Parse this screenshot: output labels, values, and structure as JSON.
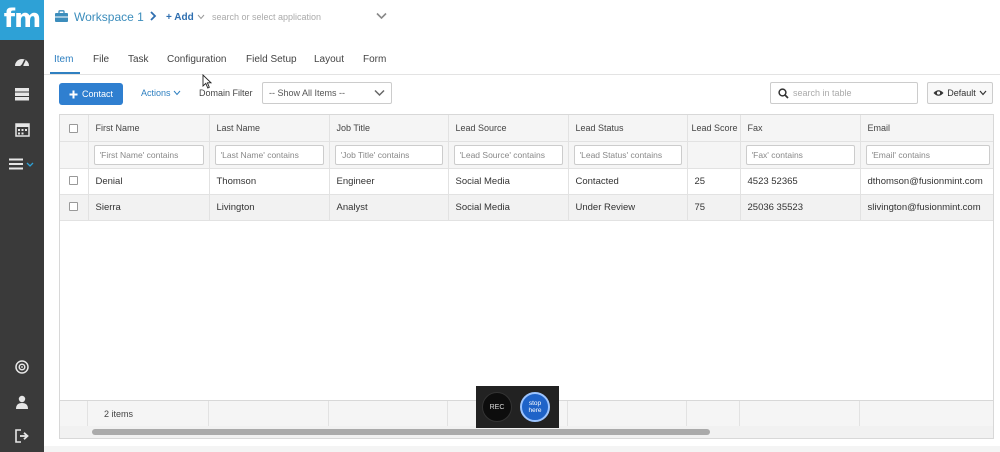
{
  "brand": {
    "logo_text": "fm",
    "accent": "#2ea1d6"
  },
  "topbar": {
    "workspace": "Workspace 1",
    "add_label": "Add",
    "app_search_placeholder": "search or select application"
  },
  "tabs": [
    {
      "label": "Item",
      "active": true
    },
    {
      "label": "File",
      "active": false
    },
    {
      "label": "Task",
      "active": false
    },
    {
      "label": "Configuration",
      "active": false
    },
    {
      "label": "Field Setup",
      "active": false
    },
    {
      "label": "Layout",
      "active": false
    },
    {
      "label": "Form",
      "active": false
    }
  ],
  "toolbar": {
    "add_contact_label": "Contact",
    "actions_label": "Actions",
    "domain_filter_label": "Domain Filter",
    "domain_filter_value": "-- Show All Items --",
    "search_placeholder": "search in table",
    "view_label": "Default"
  },
  "table": {
    "columns": [
      "First Name",
      "Last Name",
      "Job Title",
      "Lead Source",
      "Lead Status",
      "Lead Score",
      "Fax",
      "Email"
    ],
    "filters": [
      "'First Name' contains",
      "'Last Name' contains",
      "'Job Title' contains",
      "'Lead Source' contains",
      "'Lead Status' contains",
      "",
      "'Fax' contains",
      "'Email' contains"
    ],
    "rows": [
      [
        "Denial",
        "Thomson",
        "Engineer",
        "Social Media",
        "Contacted",
        "25",
        "4523 52365",
        "dthomson@fusionmint.com"
      ],
      [
        "Sierra",
        "Livington",
        "Analyst",
        "Social Media",
        "Under Review",
        "75",
        "25036 35523",
        "slivington@fusionmint.com"
      ]
    ],
    "footer_count": "2 items"
  },
  "recorder": {
    "rec_label": "REC",
    "stop_label_1": "stop",
    "stop_label_2": "here"
  }
}
